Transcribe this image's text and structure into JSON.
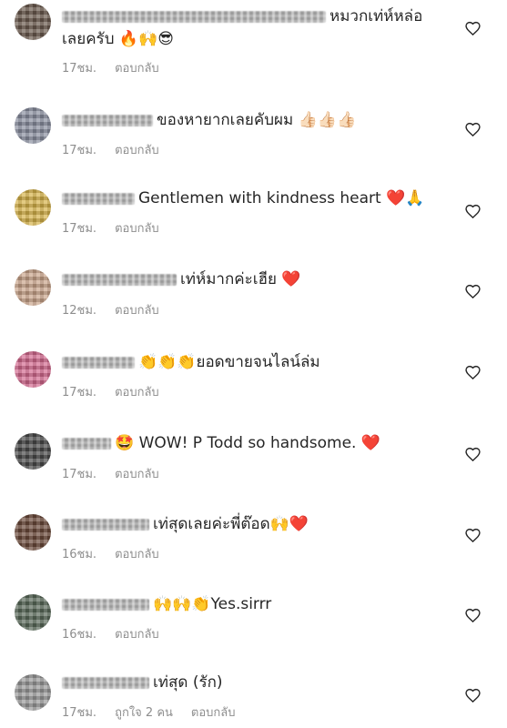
{
  "comments": [
    {
      "text": "หมวกเท่ห์หล่อเลยครับ 🔥🙌😎",
      "time": "17ชม.",
      "likes": "",
      "reply": "ตอบกลับ",
      "avatar_color": "#6b5a4e"
    },
    {
      "text": "ของหายากเลยคับผม 👍🏻👍🏻👍🏻",
      "time": "17ชม.",
      "likes": "",
      "reply": "ตอบกลับ",
      "avatar_color": "#8a8fa0"
    },
    {
      "text": "Gentlemen with kindness heart ❤️🙏",
      "time": "17ชม.",
      "likes": "",
      "reply": "ตอบกลับ",
      "avatar_color": "#d6b24a"
    },
    {
      "text": "เท่ห์มากค่ะเฮีย ❤️",
      "time": "12ชม.",
      "likes": "",
      "reply": "ตอบกลับ",
      "avatar_color": "#c9a48a"
    },
    {
      "text": "👏👏👏ยอดขายจนไลน์ล่ม",
      "time": "17ชม.",
      "likes": "",
      "reply": "ตอบกลับ",
      "avatar_color": "#d46a8f"
    },
    {
      "text": "🤩 WOW! P Todd so handsome. ❤️",
      "time": "17ชม.",
      "likes": "",
      "reply": "ตอบกลับ",
      "avatar_color": "#4a4a4a"
    },
    {
      "text": "เท่สุดเลยค่ะพี่ต๊อด🙌❤️",
      "time": "16ชม.",
      "likes": "",
      "reply": "ตอบกลับ",
      "avatar_color": "#6b4a3a"
    },
    {
      "text": "🙌🙌👏Yes.sirrr",
      "time": "16ชม.",
      "likes": "",
      "reply": "ตอบกลับ",
      "avatar_color": "#5a6a5a"
    },
    {
      "text": "เท่สุด (รัก)",
      "time": "17ชม.",
      "likes": "ถูกใจ 2 คน",
      "reply": "ตอบกลับ",
      "avatar_color": "#9a9a9a"
    }
  ]
}
